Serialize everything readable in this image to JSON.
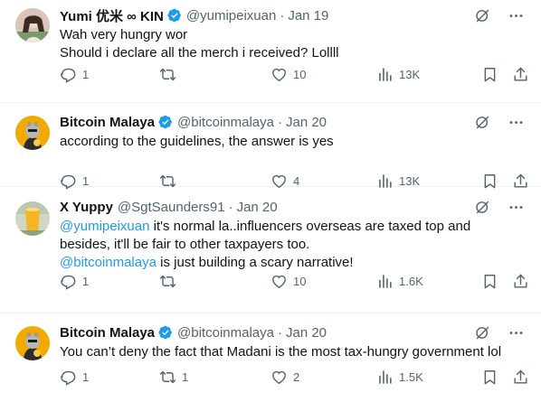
{
  "colors": {
    "accent": "#1d9bf0",
    "muted": "#536471",
    "text": "#0f1419",
    "verified": "#1d9bf0"
  },
  "tweets": [
    {
      "name": "Yumi 优米 ∞ KIN",
      "verified": true,
      "handle": "@yumipeixuan",
      "date": "Jan 19",
      "lines": [
        "Wah very hungry wor",
        "Should i declare all the merch i received? Lollll"
      ],
      "replies": "1",
      "retweets": "",
      "likes": "10",
      "views": "13K"
    },
    {
      "name": "Bitcoin Malaya",
      "verified": true,
      "handle": "@bitcoinmalaya",
      "date": "Jan 20",
      "lines": [
        "according to the guidelines, the answer is yes"
      ],
      "replies": "1",
      "retweets": "",
      "likes": "4",
      "views": "13K"
    },
    {
      "name": "X Yuppy",
      "verified": false,
      "handle": "@SgtSaunders91",
      "date": "Jan 20",
      "mention1": "@yumipeixuan",
      "line1_rest": " it's normal la..influencers overseas are taxed top and",
      "line2": "besides, it'll be fair to other taxpayers too.",
      "mention2": "@bitcoinmalaya",
      "line3_rest": " is just building a scary narrative!",
      "replies": "1",
      "retweets": "",
      "likes": "10",
      "views": "1.6K"
    },
    {
      "name": "Bitcoin Malaya",
      "verified": true,
      "handle": "@bitcoinmalaya",
      "date": "Jan 20",
      "lines": [
        "You can’t deny the fact that Madani is the most tax-hungry government lol"
      ],
      "replies": "1",
      "retweets": "1",
      "likes": "2",
      "views": "1.5K"
    }
  ]
}
